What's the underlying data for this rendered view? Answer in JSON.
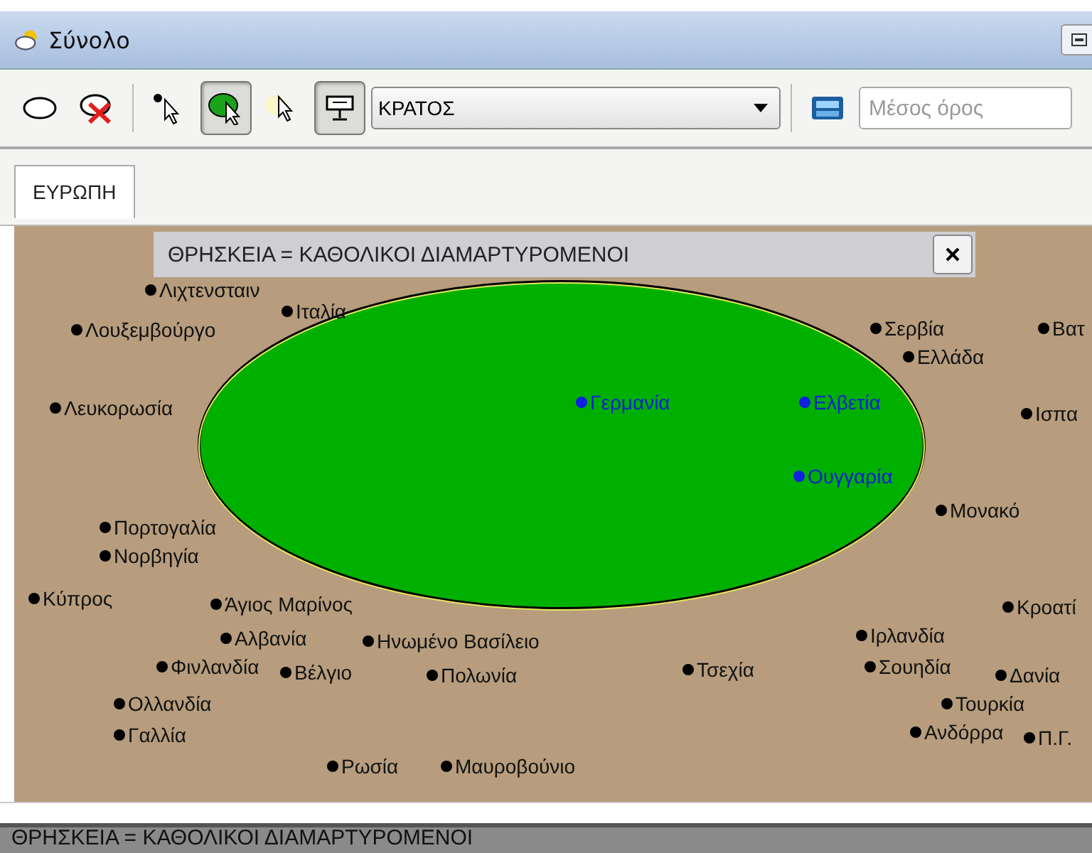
{
  "window": {
    "title": "Σύνολο"
  },
  "toolbar": {
    "tools": [
      {
        "kind": "ellipse",
        "pressed": false
      },
      {
        "kind": "clear",
        "pressed": false
      },
      {
        "kind": "point",
        "pressed": false
      },
      {
        "kind": "region",
        "pressed": true
      },
      {
        "kind": "highlight",
        "pressed": false
      },
      {
        "kind": "display",
        "pressed": true
      }
    ],
    "layer_dropdown": {
      "value": "ΚΡΑΤΟΣ"
    },
    "statistic_field": {
      "placeholder": "Μέσος όρος"
    }
  },
  "tabs": [
    {
      "label": "ΕΥΡΩΠΗ",
      "selected": true
    }
  ],
  "map": {
    "filter_banner": "ΘΡΗΣΚΕΙΑ = ΚΑΘΟΛΙΚΟΙ ΔΙΑΜΑΡΤΥΡΟΜΕΝΟΙ",
    "places": [
      {
        "name": "Λιχτενσταιν",
        "selected": false
      },
      {
        "name": "Ιταλία",
        "selected": false
      },
      {
        "name": "Λουξεμβούργο",
        "selected": false
      },
      {
        "name": "Σερβία",
        "selected": false
      },
      {
        "name": "Βατ",
        "selected": false
      },
      {
        "name": "Ελλάδα",
        "selected": false
      },
      {
        "name": "Λευκορωσία",
        "selected": false
      },
      {
        "name": "Γερμανία",
        "selected": true
      },
      {
        "name": "Ελβετία",
        "selected": true
      },
      {
        "name": "Ισπα",
        "selected": false
      },
      {
        "name": "Ουγγαρία",
        "selected": true
      },
      {
        "name": "Μονακό",
        "selected": false
      },
      {
        "name": "Πορτογαλία",
        "selected": false
      },
      {
        "name": "Νορβηγία",
        "selected": false
      },
      {
        "name": "Κύπρος",
        "selected": false
      },
      {
        "name": "Άγιος Μαρίνος",
        "selected": false
      },
      {
        "name": "Κροατί",
        "selected": false
      },
      {
        "name": "Αλβανία",
        "selected": false
      },
      {
        "name": "Ηνωμένο Βασίλειο",
        "selected": false
      },
      {
        "name": "Ιρλανδία",
        "selected": false
      },
      {
        "name": "Φινλανδία",
        "selected": false
      },
      {
        "name": "Βέλγιο",
        "selected": false
      },
      {
        "name": "Πολωνία",
        "selected": false
      },
      {
        "name": "Τσεχία",
        "selected": false
      },
      {
        "name": "Σουηδία",
        "selected": false
      },
      {
        "name": "Δανία",
        "selected": false
      },
      {
        "name": "Ολλανδία",
        "selected": false
      },
      {
        "name": "Τουρκία",
        "selected": false
      },
      {
        "name": "Γαλλία",
        "selected": false
      },
      {
        "name": "Ανδόρρα",
        "selected": false
      },
      {
        "name": "Π.Γ.",
        "selected": false
      },
      {
        "name": "Ρωσία",
        "selected": false
      },
      {
        "name": "Μαυροβούνιο",
        "selected": false
      }
    ]
  },
  "status_bar": {
    "text": "ΘΡΗΣΚΕΙΑ = ΚΑΘΟΛΙΚΟΙ ΔΙΑΜΑΡΤΥΡΟΜΕΝΟΙ"
  }
}
